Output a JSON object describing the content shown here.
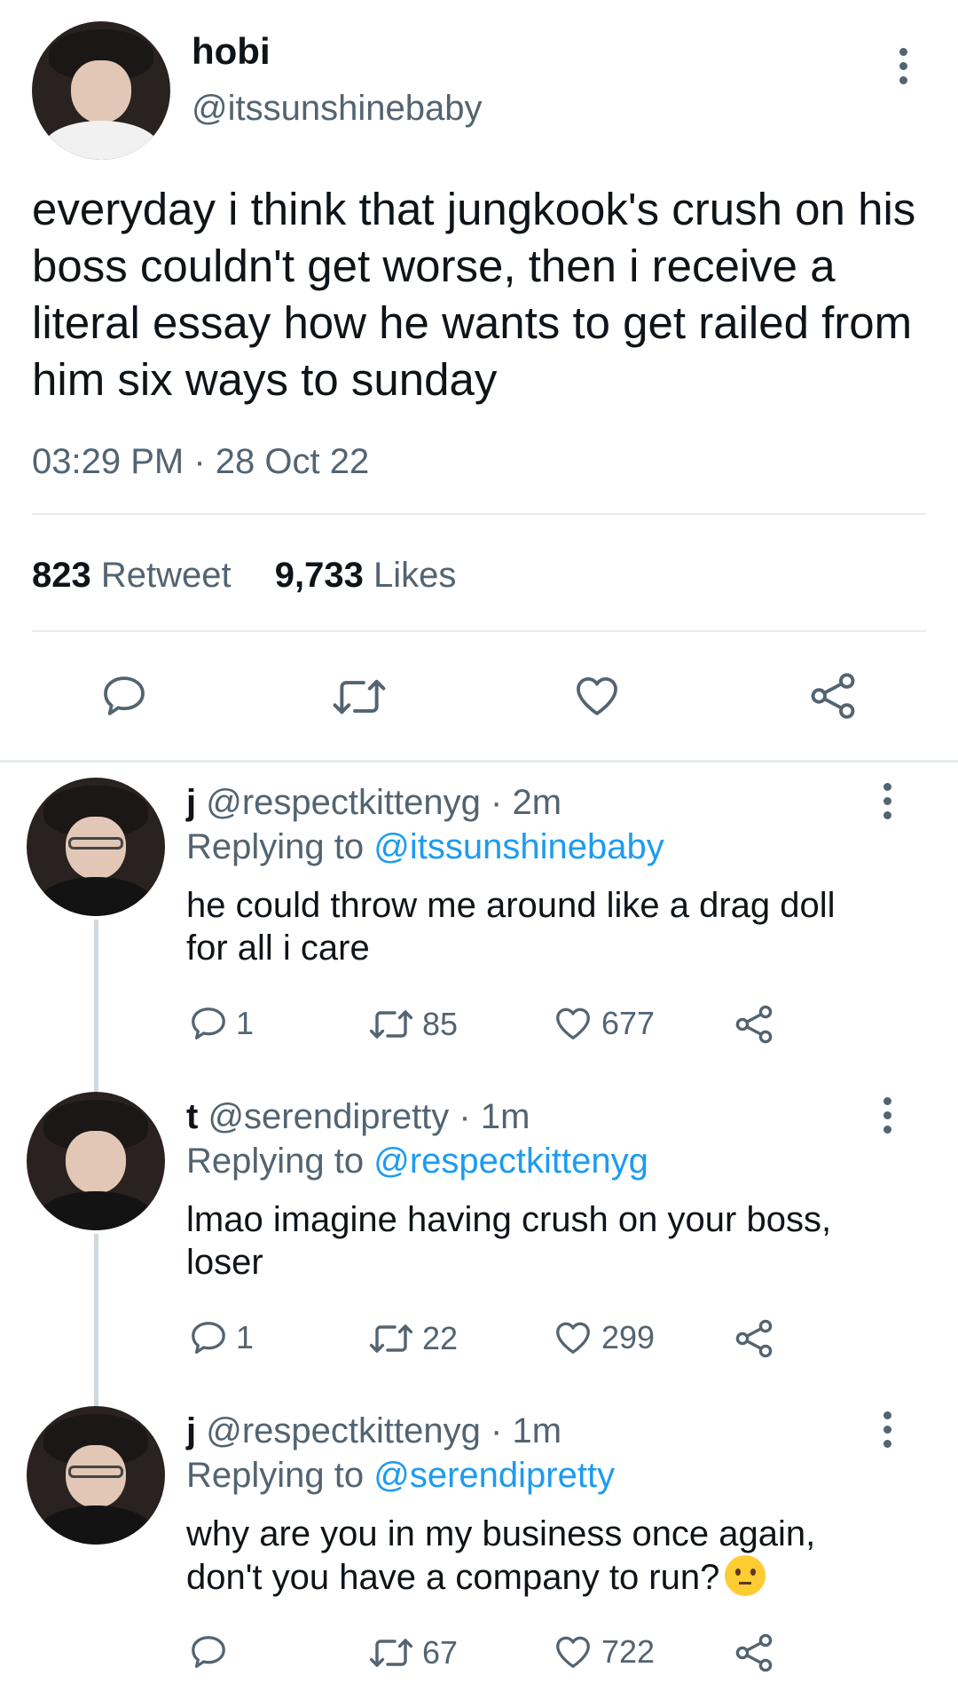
{
  "main_tweet": {
    "author_name": "hobi",
    "handle": "@itssunshinebaby",
    "text": "everyday i think that jungkook's crush on his boss couldn't get worse, then i receive a literal essay how he wants to get railed from him six ways to sunday",
    "time": "03:29 PM",
    "separator": "·",
    "date": "28 Oct 22",
    "retweets_count": "823",
    "retweets_label": "Retweet",
    "likes_count": "9,733",
    "likes_label": "Likes"
  },
  "replies": [
    {
      "author_name": "j",
      "handle": "@respectkittenyg",
      "time": "2m",
      "replying_label": "Replying to",
      "replying_to": "@itssunshinebaby",
      "text_line1": "he could throw me around like a drag doll",
      "text_line2": "for all i care",
      "reply_count": "1",
      "retweet_count": "85",
      "like_count": "677"
    },
    {
      "author_name": "t",
      "handle": "@serendipretty",
      "time": "1m",
      "replying_label": "Replying to",
      "replying_to": "@respectkittenyg",
      "text_line1": "lmao imagine having crush on your boss,",
      "text_line2": "loser",
      "reply_count": "1",
      "retweet_count": "22",
      "like_count": "299"
    },
    {
      "author_name": "j",
      "handle": "@respectkittenyg",
      "time": "1m",
      "replying_label": "Replying to",
      "replying_to": "@serendipretty",
      "text_line1": "why are you in my business once again,",
      "text_line2": "don't you have a company to run?",
      "emoji": "hushed-face-emoji",
      "reply_count": "",
      "retweet_count": "67",
      "like_count": "722"
    }
  ],
  "icons": {
    "reply": "comment-bubble-icon",
    "retweet": "retweet-icon",
    "like": "heart-icon",
    "share": "share-icon",
    "more": "more-vertical-icon"
  },
  "colors": {
    "text": "#0f1419",
    "muted": "#536471",
    "link": "#1d9bf0",
    "divider": "#e6ecf0"
  }
}
